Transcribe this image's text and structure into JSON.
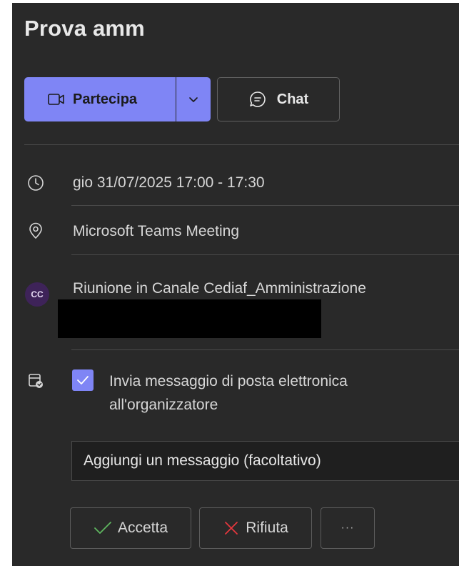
{
  "meeting": {
    "title": "Prova amm"
  },
  "toolbar": {
    "join_label": "Partecipa",
    "chat_label": "Chat"
  },
  "details": {
    "datetime": "gio 31/07/2025 17:00 - 17:30",
    "location": "Microsoft Teams Meeting",
    "channel_avatar": "CC",
    "channel": "Riunione in Canale Cediaf_Amministrazione"
  },
  "response": {
    "send_email_label": "Invia messaggio di posta elettronica\nall'organizzatore",
    "send_email_checked": true,
    "message_placeholder": "Aggiungi un messaggio (facoltativo)",
    "accept_label": "Accetta",
    "decline_label": "Rifiuta",
    "more_label": "···"
  },
  "colors": {
    "accent": "#7f85f5",
    "accept": "#5fb760",
    "decline": "#e5373d",
    "panel": "#292929"
  },
  "icons": {
    "join": "video-camera-icon",
    "split": "chevron-down-icon",
    "chat": "chat-bubble-icon",
    "time": "clock-icon",
    "location": "location-pin-icon",
    "email": "calendar-mail-icon",
    "accept": "checkmark-icon",
    "decline": "x-mark-icon"
  }
}
